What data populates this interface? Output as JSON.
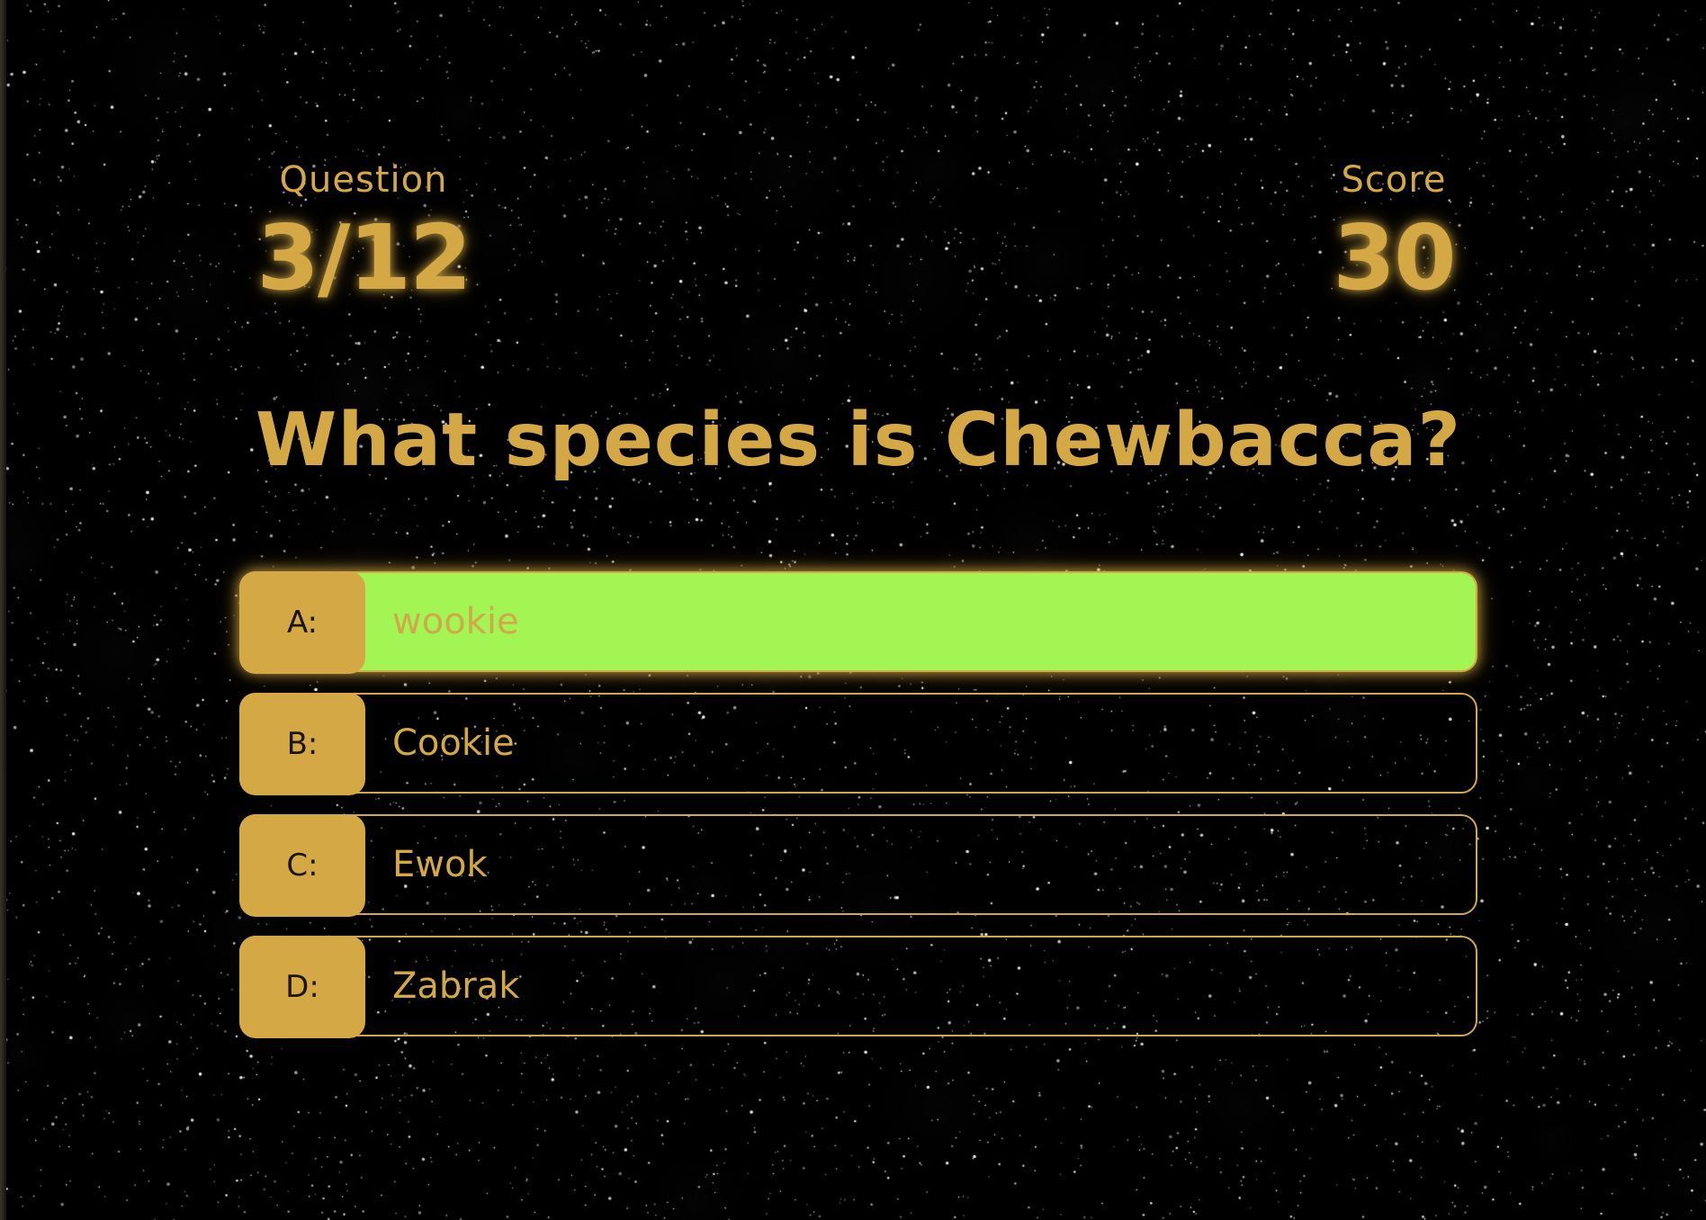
{
  "hud": {
    "question_label": "Question",
    "question_progress": "3/12",
    "score_label": "Score",
    "score_value": "30"
  },
  "question": {
    "text": "What species is Chewbacca?"
  },
  "answers": [
    {
      "letter": "A:",
      "text": "wookie",
      "state": "correct"
    },
    {
      "letter": "B:",
      "text": "Cookie",
      "state": "default"
    },
    {
      "letter": "C:",
      "text": "Ewok",
      "state": "default"
    },
    {
      "letter": "D:",
      "text": "Zabrak",
      "state": "default"
    }
  ],
  "colors": {
    "accent": "#d4a845",
    "correct_fill": "#a3f553",
    "background": "#000000"
  }
}
